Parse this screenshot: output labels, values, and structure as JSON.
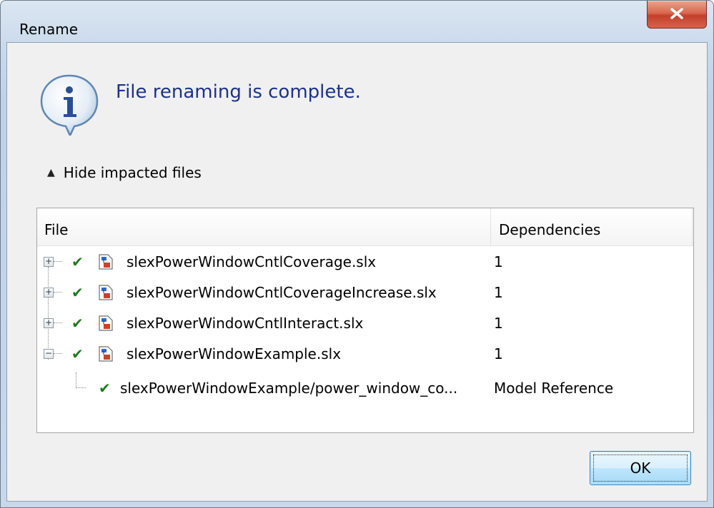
{
  "window": {
    "title": "Rename"
  },
  "message": {
    "text": "File renaming is complete."
  },
  "toggle": {
    "label": "Hide impacted files"
  },
  "table": {
    "columns": {
      "file": "File",
      "dependencies": "Dependencies"
    },
    "rows": [
      {
        "name": "slexPowerWindowCntlCoverage.slx",
        "dependencies": "1"
      },
      {
        "name": "slexPowerWindowCntlCoverageIncrease.slx",
        "dependencies": "1"
      },
      {
        "name": "slexPowerWindowCntlInteract.slx",
        "dependencies": "1"
      },
      {
        "name": "slexPowerWindowExample.slx",
        "dependencies": "1"
      }
    ],
    "child": {
      "name": "slexPowerWindowExample/power_window_co...",
      "dependencies": "Model Reference"
    }
  },
  "buttons": {
    "ok": "OK"
  }
}
